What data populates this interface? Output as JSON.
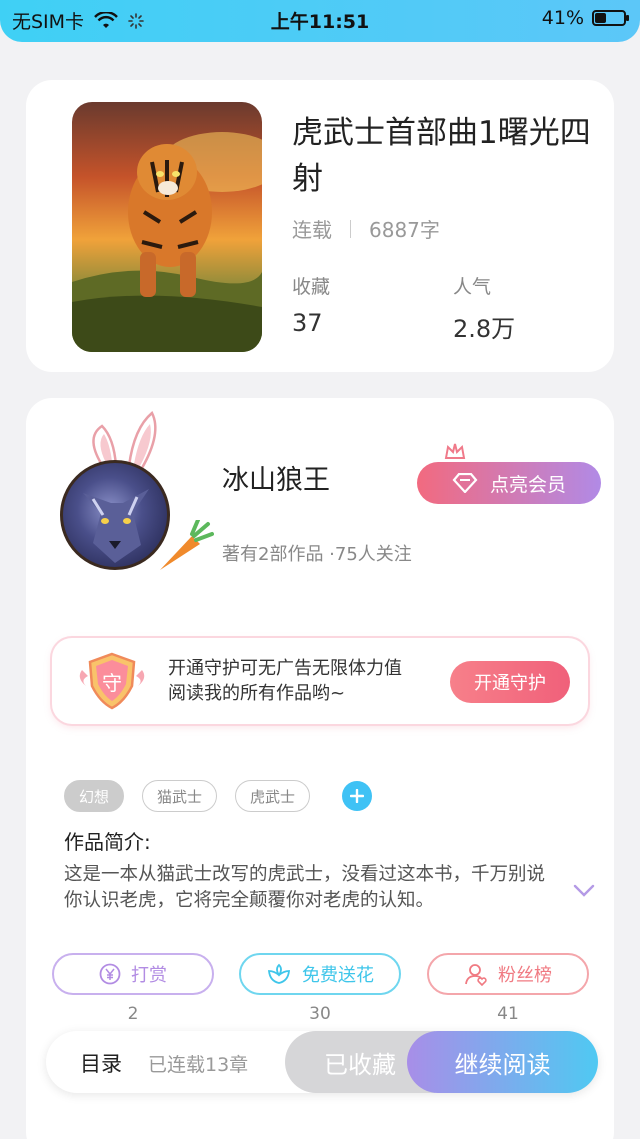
{
  "status_bar": {
    "carrier": "无SIM卡",
    "time": "上午11:51",
    "battery": "41%",
    "battery_level": 0.41
  },
  "book": {
    "title": "虎武士首部曲1曙光四射",
    "status": "连载",
    "word_count": "6887字",
    "favorites_label": "收藏",
    "favorites_value": "37",
    "popularity_label": "人气",
    "popularity_value": "2.8万"
  },
  "author": {
    "name": "冰山狼王",
    "summary": "著有2部作品 ·75人关注",
    "vip_button": "点亮会员"
  },
  "guard": {
    "badge_char": "守",
    "text": "开通守护可无广告无限体力值阅读我的所有作品哟~",
    "button": "开通守护"
  },
  "tags": [
    "幻想",
    "猫武士",
    "虎武士"
  ],
  "intro": {
    "heading": "作品简介:",
    "body": "这是一本从猫武士改写的虎武士，没看过这本书，千万别说你认识老虎，它将完全颠覆你对老虎的认知。"
  },
  "actions": [
    {
      "label": "打赏",
      "count": "2",
      "icon": "yen-coin-icon",
      "color": "#b28ce3"
    },
    {
      "label": "免费送花",
      "count": "30",
      "icon": "flower-icon",
      "color": "#3fc6ea"
    },
    {
      "label": "粉丝榜",
      "count": "41",
      "icon": "fans-user-icon",
      "color": "#f07a82"
    }
  ],
  "bottom_bar": {
    "toc": "目录",
    "chapters": "已连载13章",
    "favorited": "已收藏",
    "continue_reading": "继续阅读"
  }
}
